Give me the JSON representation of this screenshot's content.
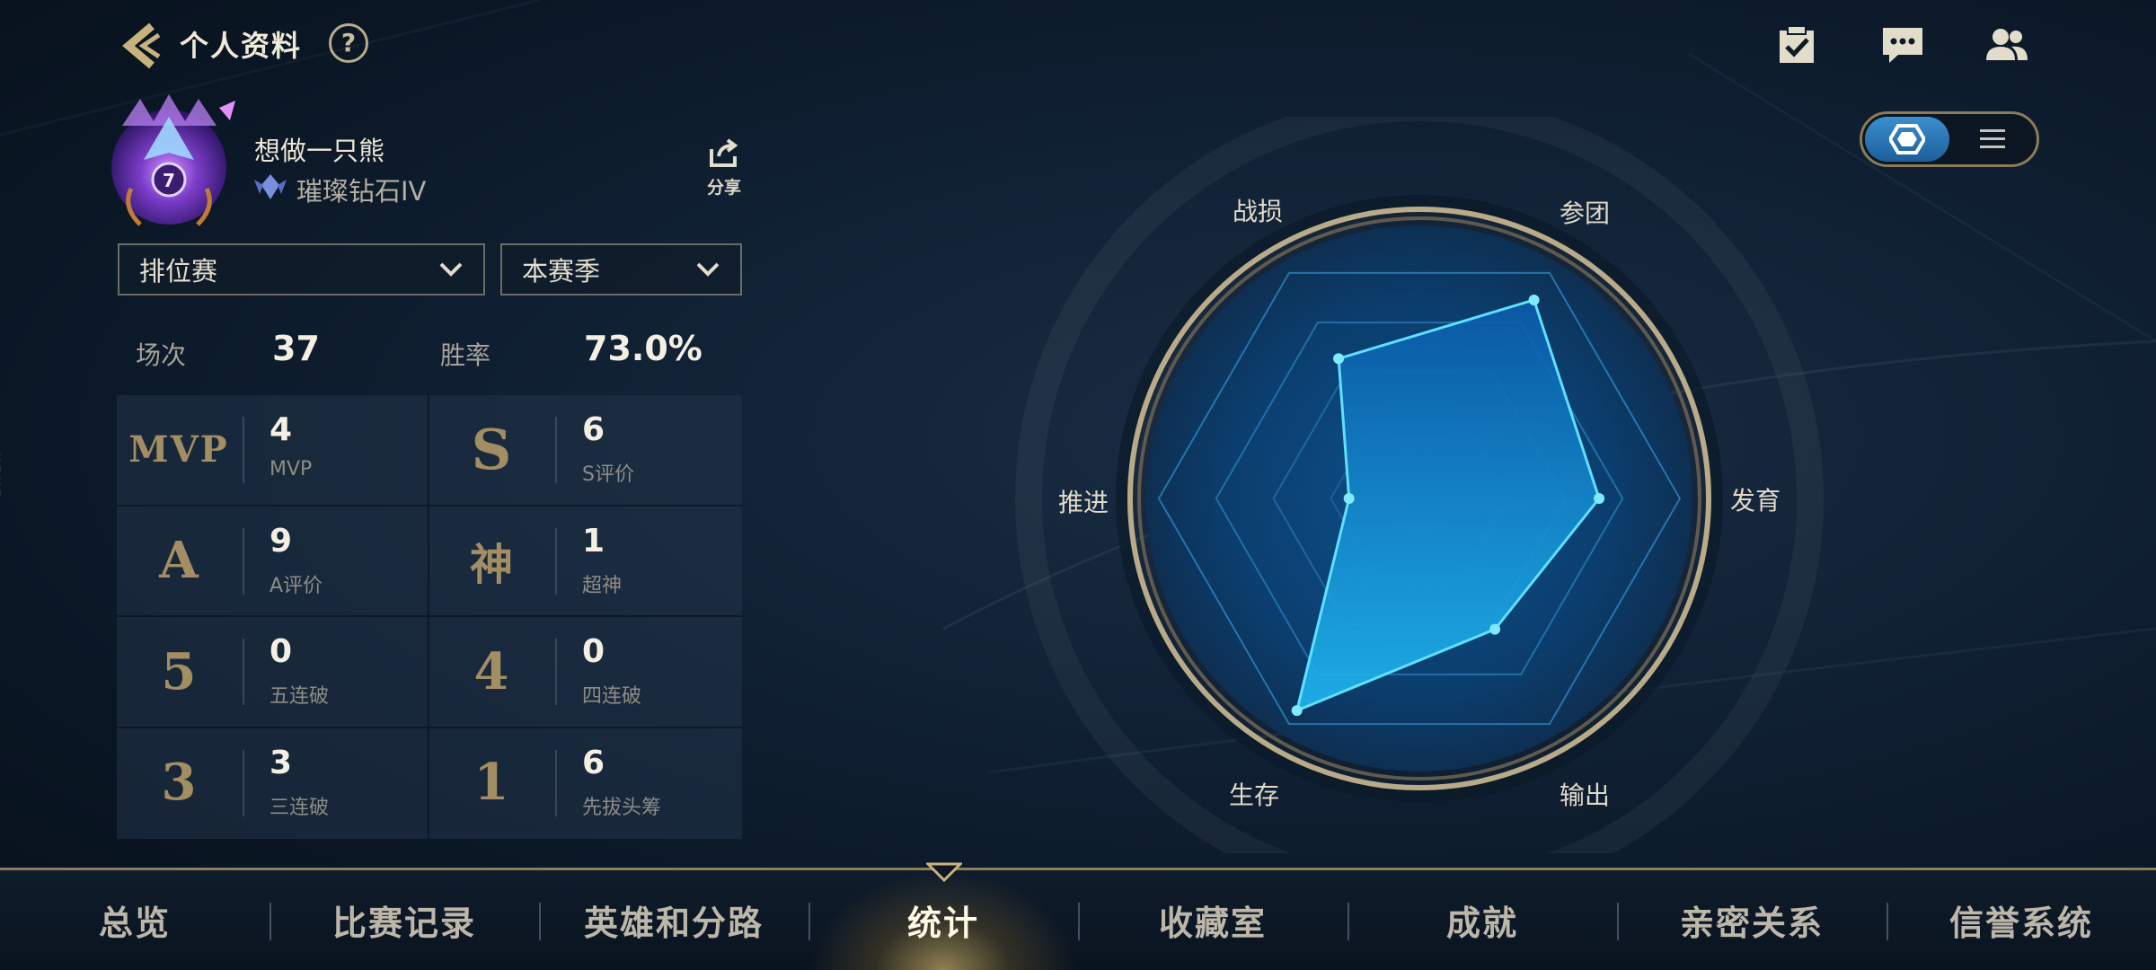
{
  "header": {
    "title": "个人资料",
    "help_label": "?"
  },
  "profile": {
    "name": "想做一只熊",
    "rank": "璀璨钻石IV",
    "share_label": "分享"
  },
  "filters": {
    "mode": "排位赛",
    "season": "本赛季"
  },
  "summary": {
    "matches_label": "场次",
    "matches_value": "37",
    "winrate_label": "胜率",
    "winrate_value": "73.0%"
  },
  "stats": [
    {
      "icon_text": "MVP",
      "value": "4",
      "label": "MVP"
    },
    {
      "icon_text": "S",
      "value": "6",
      "label": "S评价"
    },
    {
      "icon_text": "A",
      "value": "9",
      "label": "A评价"
    },
    {
      "icon_text": "神",
      "value": "1",
      "label": "超神"
    },
    {
      "icon_text": "5",
      "value": "0",
      "label": "五连破"
    },
    {
      "icon_text": "4",
      "value": "0",
      "label": "四连破"
    },
    {
      "icon_text": "3",
      "value": "3",
      "label": "三连破"
    },
    {
      "icon_text": "1",
      "value": "6",
      "label": "先拔头筹"
    }
  ],
  "radar": {
    "axes": [
      "发育",
      "参团",
      "战损",
      "推进",
      "生存",
      "输出"
    ],
    "values": [
      0.69,
      0.88,
      0.62,
      0.27,
      0.94,
      0.58
    ],
    "accent": "#18c8ff"
  },
  "tabs": [
    "总览",
    "比赛记录",
    "英雄和分路",
    "统计",
    "收藏室",
    "成就",
    "亲密关系",
    "信誉系统"
  ],
  "active_tab": "统计",
  "side_code": "417627"
}
